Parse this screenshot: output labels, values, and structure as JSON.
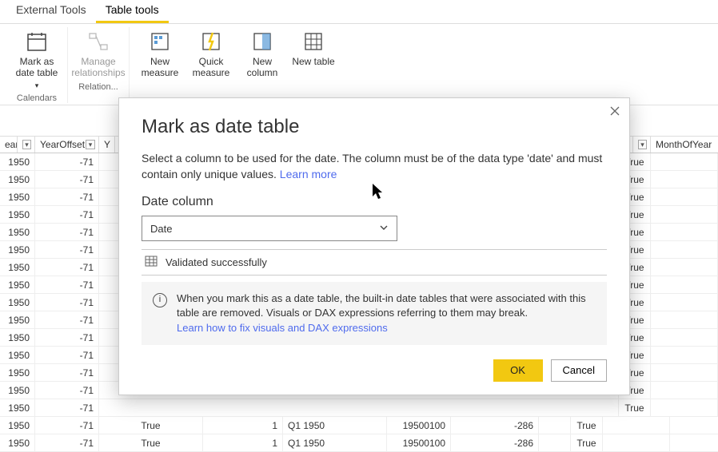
{
  "tabs": {
    "external": "External Tools",
    "table_tools": "Table tools"
  },
  "ribbon": {
    "calendars_label": "Calendars",
    "relationships_label": "Relation...",
    "mark_date_table": "Mark as date table",
    "manage_rel": "Manage relationships",
    "new_measure": "New measure",
    "quick_measure": "Quick measure",
    "new_column": "New column",
    "new_table": "New table"
  },
  "columns": {
    "year": "ear",
    "yearoffset": "YearOffset",
    "y": "Y",
    "monthofyear": "MonthOfYear"
  },
  "table": {
    "rows": [
      {
        "year": "1950",
        "offset": "-71",
        "true": "True"
      },
      {
        "year": "1950",
        "offset": "-71",
        "true": "True"
      },
      {
        "year": "1950",
        "offset": "-71",
        "true": "True"
      },
      {
        "year": "1950",
        "offset": "-71",
        "true": "True"
      },
      {
        "year": "1950",
        "offset": "-71",
        "true": "True"
      },
      {
        "year": "1950",
        "offset": "-71",
        "true": "True"
      },
      {
        "year": "1950",
        "offset": "-71",
        "true": "True"
      },
      {
        "year": "1950",
        "offset": "-71",
        "true": "True"
      },
      {
        "year": "1950",
        "offset": "-71",
        "true": "True"
      },
      {
        "year": "1950",
        "offset": "-71",
        "true": "True"
      },
      {
        "year": "1950",
        "offset": "-71",
        "true": "True"
      },
      {
        "year": "1950",
        "offset": "-71",
        "true": "True"
      },
      {
        "year": "1950",
        "offset": "-71",
        "true": "True"
      },
      {
        "year": "1950",
        "offset": "-71",
        "true": "True"
      },
      {
        "year": "1950",
        "offset": "-71",
        "true": "True"
      }
    ],
    "bottom": [
      {
        "year": "1950",
        "offset": "-71",
        "true": "True",
        "n": "1",
        "q": "Q1 1950",
        "num": "19500100",
        "off": "-286",
        "t2": "True"
      },
      {
        "year": "1950",
        "offset": "-71",
        "true": "True",
        "n": "1",
        "q": "Q1 1950",
        "num": "19500100",
        "off": "-286",
        "t2": "True"
      }
    ]
  },
  "dialog": {
    "title": "Mark as date table",
    "desc": "Select a column to be used for the date. The column must be of the data type 'date' and must contain only unique values. ",
    "learn_more": "Learn more",
    "col_label": "Date column",
    "selected": "Date",
    "validated": "Validated successfully",
    "warning": "When you mark this as a date table, the built-in date tables that were associated with this table are removed. Visuals or DAX expressions referring to them may break.",
    "learn_fix": "Learn how to fix visuals and DAX expressions",
    "ok": "OK",
    "cancel": "Cancel"
  }
}
